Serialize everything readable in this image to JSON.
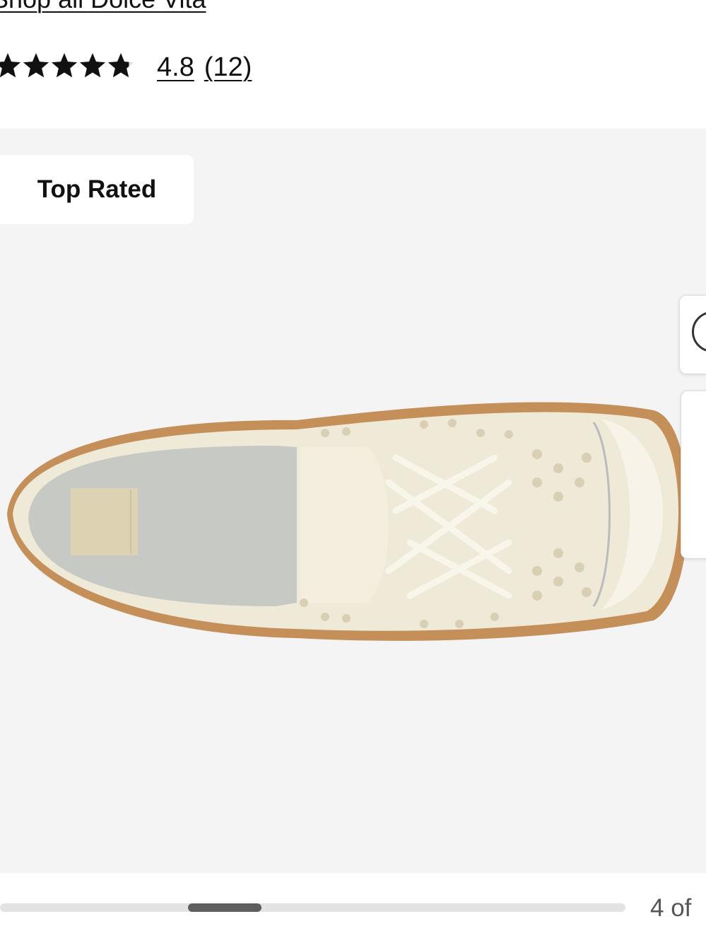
{
  "brand_link": "Shop all Dolce Vita",
  "rating": {
    "stars_filled": 4.8,
    "stars_total": 5,
    "value": "4.8",
    "count": "(12)"
  },
  "gallery": {
    "badge": "Top Rated",
    "slide_position": 0.3,
    "counter": "4 of"
  },
  "colors": {
    "gallery_bg": "#f4f4f4",
    "shoe_cream": "#eee7d4",
    "sole_tan": "#c48f59",
    "scroll_thumb": "#5f5f5f"
  },
  "icons": [
    "star-icon",
    "zoom-icon"
  ]
}
